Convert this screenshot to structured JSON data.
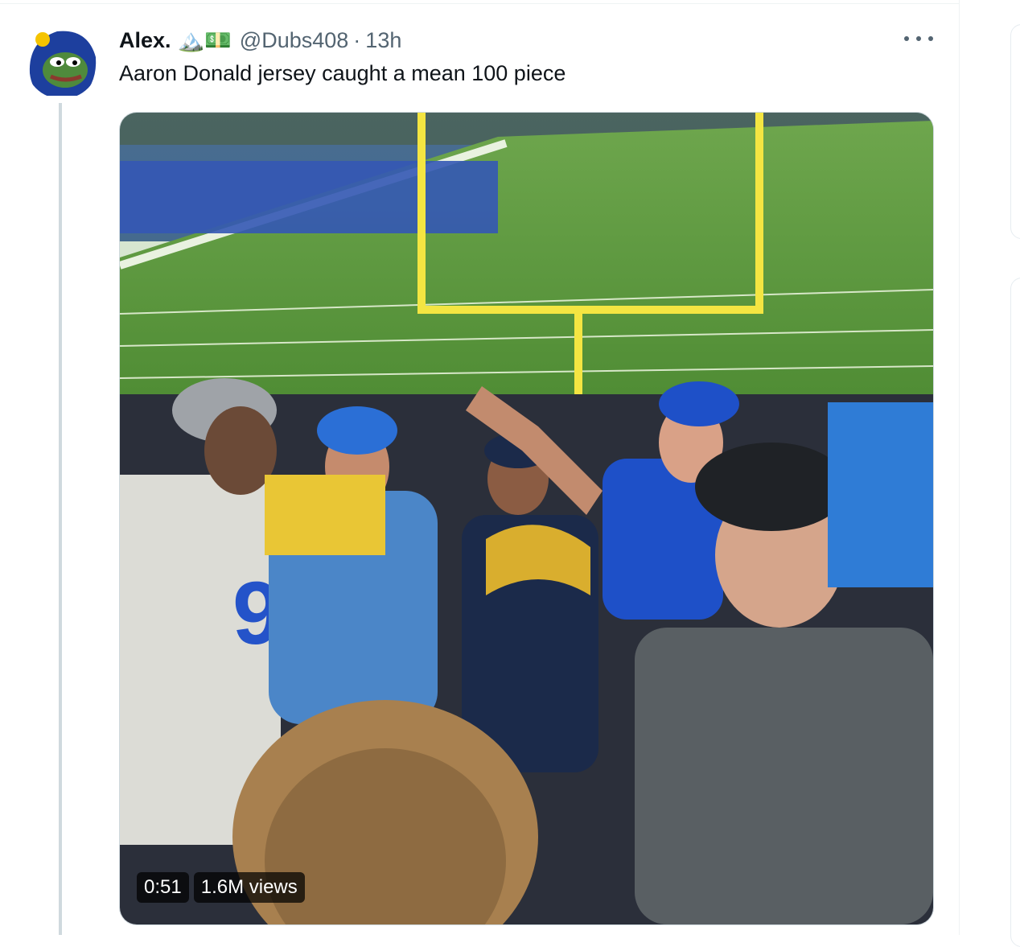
{
  "tweet": {
    "display_name": "Alex.",
    "name_emojis": "🏔️💵",
    "handle": "@Dubs408",
    "separator": "·",
    "time": "13h",
    "text": "Aaron Donald jersey caught a mean 100 piece",
    "icons": {
      "avatar": "pepe-warriors-hoodie-avatar",
      "more": "more-horizontal-icon"
    }
  },
  "video": {
    "duration": "0:51",
    "views": "1.6M views",
    "description": "fans arguing in stadium stands at a Rams game"
  },
  "colors": {
    "text": "#0f1419",
    "secondary": "#536471",
    "rams_blue": "#1d4ed8",
    "rams_gold": "#f5c400"
  }
}
